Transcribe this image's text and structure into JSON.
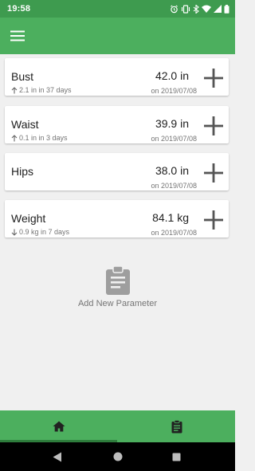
{
  "status_bar": {
    "time": "19:58",
    "icons": [
      "alarm-icon",
      "vibrate-icon",
      "bluetooth-icon",
      "wifi-icon",
      "signal-icon",
      "battery-icon"
    ]
  },
  "app_bar": {
    "menu_icon": "menu-icon"
  },
  "parameters": [
    {
      "name": "Bust",
      "change": "2.1 in in 37 days",
      "trend": "up",
      "value": "42.0 in",
      "date": "on 2019/07/08"
    },
    {
      "name": "Waist",
      "change": "0.1 in in 3 days",
      "trend": "up",
      "value": "39.9 in",
      "date": "on 2019/07/08"
    },
    {
      "name": "Hips",
      "change": "",
      "trend": "none",
      "value": "38.0 in",
      "date": "on 2019/07/08"
    },
    {
      "name": "Weight",
      "change": "0.9 kg in 7 days",
      "trend": "down",
      "value": "84.1 kg",
      "date": "on 2019/07/08"
    }
  ],
  "add_parameter": {
    "label": "Add New Parameter",
    "icon": "clipboard-icon"
  },
  "bottom_nav": {
    "tabs": [
      {
        "icon": "home-icon",
        "selected": true
      },
      {
        "icon": "clipboard-icon",
        "selected": false
      }
    ]
  },
  "system_nav": {
    "buttons": [
      "back-icon",
      "home-circle-icon",
      "recents-icon"
    ]
  },
  "colors": {
    "status_bar": "#3e9b4f",
    "app_bar": "#4caf5e",
    "background": "#f0f0f0",
    "card": "#ffffff",
    "text_primary": "#212121",
    "text_secondary": "#757575",
    "add_icon": "#555555"
  }
}
